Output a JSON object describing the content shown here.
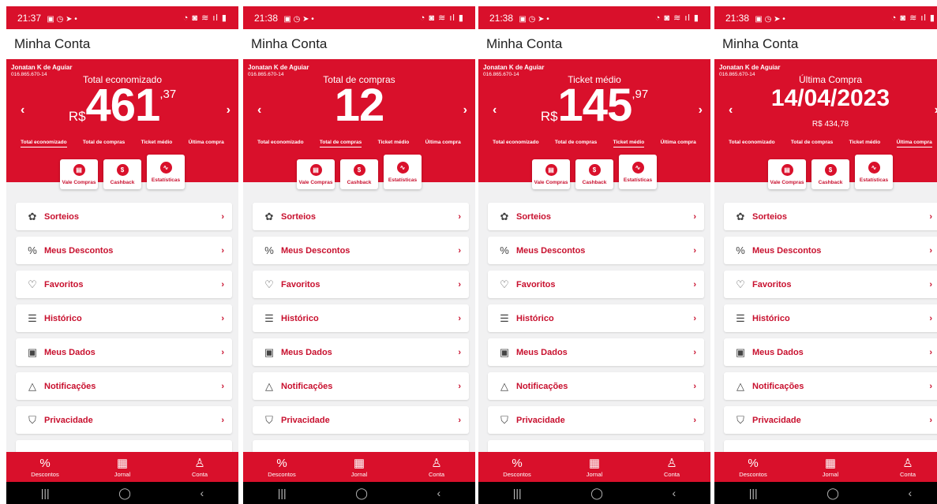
{
  "screens": [
    {
      "status_time": "21:37",
      "status_extra": "▣ ◷ ➤ •",
      "status_right": "◔ ◙ ≋ ıl ▮",
      "appbar_title": "Minha Conta",
      "user_name": "Jonatan K de Aguiar",
      "user_doc": "016.865.670-14",
      "metric_label": "Total economizado",
      "currency": "R$",
      "value_int": "461",
      "value_dec": ",37",
      "sub": "",
      "tabs": [
        "Total economizado",
        "Total de compras",
        "Ticket médio",
        "Última compra"
      ],
      "active_tab": 0,
      "actions": [
        "Vale Compras",
        "Cashback",
        "Estatísticas"
      ],
      "menu": [
        "Sorteios",
        "Meus Descontos",
        "Favoritos",
        "Histórico",
        "Meus Dados",
        "Notificações",
        "Privacidade"
      ],
      "nav": [
        "Descontos",
        "Jornal",
        "Conta"
      ]
    },
    {
      "status_time": "21:38",
      "status_extra": "▣ ◷ ➤ •",
      "status_right": "◔ ◙ ≋ ıl ▮",
      "appbar_title": "Minha Conta",
      "user_name": "Jonatan K de Aguiar",
      "user_doc": "016.865.670-14",
      "metric_label": "Total de compras",
      "currency": "",
      "value_int": "12",
      "value_dec": "",
      "sub": "",
      "tabs": [
        "Total economizado",
        "Total de compras",
        "Ticket médio",
        "Última compra"
      ],
      "active_tab": 1,
      "actions": [
        "Vale Compras",
        "Cashback",
        "Estatísticas"
      ],
      "menu": [
        "Sorteios",
        "Meus Descontos",
        "Favoritos",
        "Histórico",
        "Meus Dados",
        "Notificações",
        "Privacidade"
      ],
      "nav": [
        "Descontos",
        "Jornal",
        "Conta"
      ]
    },
    {
      "status_time": "21:38",
      "status_extra": "▣ ◷ ➤ •",
      "status_right": "◔ ◙ ≋ ıl ▮",
      "appbar_title": "Minha Conta",
      "user_name": "Jonatan K de Aguiar",
      "user_doc": "016.865.670-14",
      "metric_label": "Ticket médio",
      "currency": "R$",
      "value_int": "145",
      "value_dec": ",97",
      "sub": "",
      "tabs": [
        "Total economizado",
        "Total de compras",
        "Ticket médio",
        "Última compra"
      ],
      "active_tab": 2,
      "actions": [
        "Vale Compras",
        "Cashback",
        "Estatísticas"
      ],
      "menu": [
        "Sorteios",
        "Meus Descontos",
        "Favoritos",
        "Histórico",
        "Meus Dados",
        "Notificações",
        "Privacidade"
      ],
      "nav": [
        "Descontos",
        "Jornal",
        "Conta"
      ]
    },
    {
      "status_time": "21:38",
      "status_extra": "▣ ◷ ➤ •",
      "status_right": "◔ ◙ ≋ ıl ▮",
      "appbar_title": "Minha Conta",
      "user_name": "Jonatan K de Aguiar",
      "user_doc": "016.865.670-14",
      "metric_label": "Última Compra",
      "currency": "",
      "value_int": "14/04/2023",
      "value_dec": "",
      "sub": "R$ 434,78",
      "tabs": [
        "Total economizado",
        "Total de compras",
        "Ticket médio",
        "Última compra"
      ],
      "active_tab": 3,
      "actions": [
        "Vale Compras",
        "Cashback",
        "Estatísticas"
      ],
      "menu": [
        "Sorteios",
        "Meus Descontos",
        "Favoritos",
        "Histórico",
        "Meus Dados",
        "Notificações",
        "Privacidade"
      ],
      "nav": [
        "Descontos",
        "Jornal",
        "Conta"
      ]
    }
  ],
  "icons": {
    "menu": [
      "raffle-icon",
      "percent-icon",
      "heart-icon",
      "history-icon",
      "id-card-icon",
      "bell-icon",
      "shield-icon"
    ],
    "nav": [
      "percent-icon",
      "newspaper-icon",
      "user-icon"
    ],
    "actions": [
      "voucher-icon",
      "cashback-icon",
      "chart-icon"
    ]
  },
  "colors": {
    "brand_red": "#d9102b",
    "text_red": "#c8102e"
  }
}
